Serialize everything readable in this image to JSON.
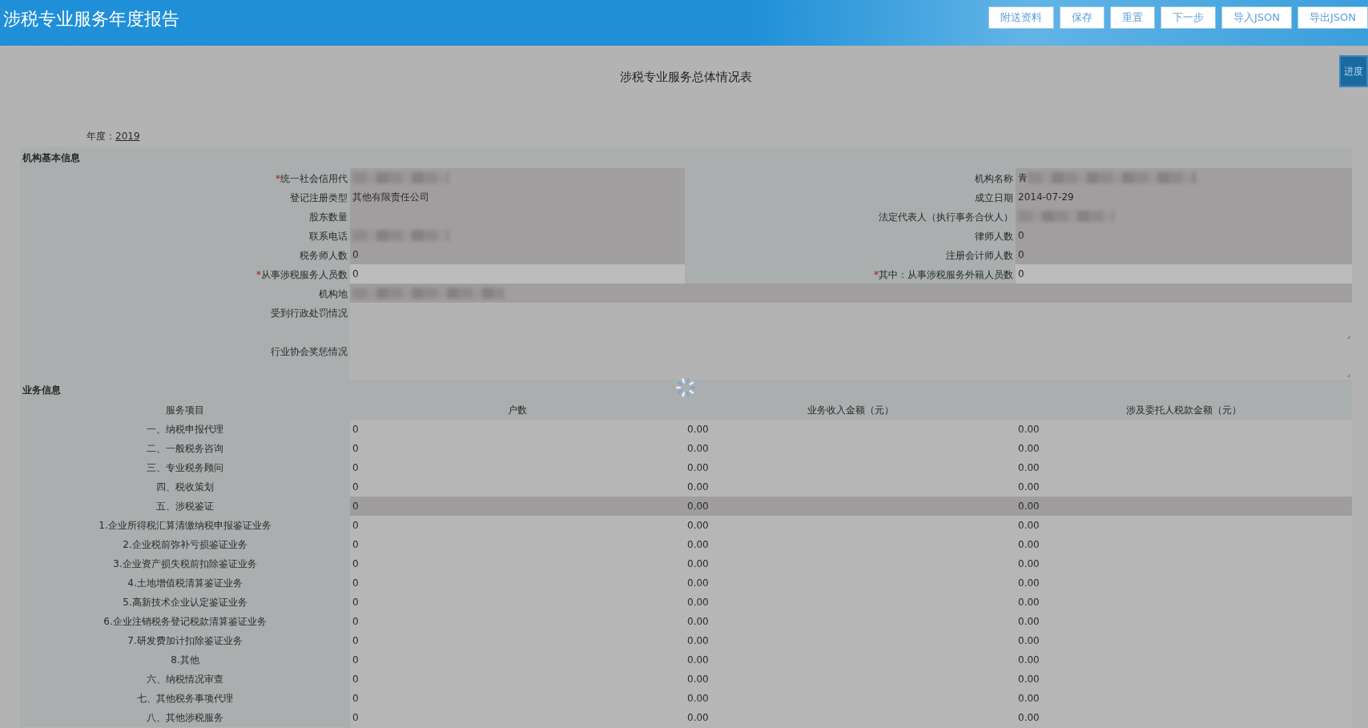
{
  "header": {
    "title": "涉税专业服务年度报告",
    "buttons": [
      "附送资料",
      "保存",
      "重置",
      "下一步",
      "导入JSON",
      "导出JSON"
    ]
  },
  "side_tab": "进度",
  "form_title": "涉税专业服务总体情况表",
  "year": {
    "label": "年度：",
    "value": "2019"
  },
  "loading": true,
  "required_mark": "*",
  "basic_info": {
    "title": "机构基本信息",
    "rows": [
      {
        "kind": "pair",
        "left": {
          "label": "统一社会信用代",
          "required": true,
          "redacted": true,
          "shaded": true
        },
        "right": {
          "label": "机构名称",
          "value": "青",
          "redacted": true,
          "shaded": true
        }
      },
      {
        "kind": "pair",
        "left": {
          "label": "登记注册类型",
          "value": "其他有限责任公司",
          "shaded": true
        },
        "right": {
          "label": "成立日期",
          "value": "2014-07-29",
          "shaded": true
        }
      },
      {
        "kind": "pair",
        "left": {
          "label": "股东数量",
          "shaded": true
        },
        "right": {
          "label": "法定代表人（执行事务合伙人）",
          "redacted": true,
          "shaded": true
        }
      },
      {
        "kind": "pair",
        "left": {
          "label": "联系电话",
          "redacted": true,
          "shaded": true
        },
        "right": {
          "label": "律师人数",
          "value": "0",
          "shaded": true
        }
      },
      {
        "kind": "pair",
        "left": {
          "label": "税务师人数",
          "value": "0",
          "shaded": true
        },
        "right": {
          "label": "注册会计师人数",
          "value": "0",
          "shaded": true
        }
      },
      {
        "kind": "pair",
        "left": {
          "label": "从事涉税服务人员数",
          "required": true,
          "value": "0",
          "shaded": false
        },
        "right": {
          "label": "其中：从事涉税服务外籍人员数",
          "required": true,
          "value": "0",
          "shaded": false
        }
      },
      {
        "kind": "wide",
        "label": "机构地",
        "redacted": true
      },
      {
        "kind": "textarea",
        "label": "受到行政处罚情况"
      },
      {
        "kind": "textarea",
        "label": "行业协会奖惩情况"
      }
    ]
  },
  "business_info": {
    "title": "业务信息",
    "columns": [
      "服务项目",
      "户数",
      "业务收入金额（元）",
      "涉及委托人税款金额（元）"
    ],
    "rows": [
      {
        "item": "一、纳税申报代理",
        "count": "0",
        "income": "0.00",
        "tax": "0.00",
        "selected": false
      },
      {
        "item": "二、一般税务咨询",
        "count": "0",
        "income": "0.00",
        "tax": "0.00",
        "selected": false
      },
      {
        "item": "三、专业税务顾问",
        "count": "0",
        "income": "0.00",
        "tax": "0.00",
        "selected": false
      },
      {
        "item": "四、税收策划",
        "count": "0",
        "income": "0.00",
        "tax": "0.00",
        "selected": false
      },
      {
        "item": "五、涉税鉴证",
        "count": "0",
        "income": "0.00",
        "tax": "0.00",
        "selected": true
      },
      {
        "item": "1.企业所得税汇算清缴纳税申报鉴证业务",
        "count": "0",
        "income": "0.00",
        "tax": "0.00",
        "selected": false
      },
      {
        "item": "2.企业税前弥补亏损鉴证业务",
        "count": "0",
        "income": "0.00",
        "tax": "0.00",
        "selected": false
      },
      {
        "item": "3.企业资产损失税前扣除鉴证业务",
        "count": "0",
        "income": "0.00",
        "tax": "0.00",
        "selected": false
      },
      {
        "item": "4.土地增值税清算鉴证业务",
        "count": "0",
        "income": "0.00",
        "tax": "0.00",
        "selected": false
      },
      {
        "item": "5.高新技术企业认定鉴证业务",
        "count": "0",
        "income": "0.00",
        "tax": "0.00",
        "selected": false
      },
      {
        "item": "6.企业注销税务登记税款清算鉴证业务",
        "count": "0",
        "income": "0.00",
        "tax": "0.00",
        "selected": false
      },
      {
        "item": "7.研发费加计扣除鉴证业务",
        "count": "0",
        "income": "0.00",
        "tax": "0.00",
        "selected": false
      },
      {
        "item": "8.其他",
        "count": "0",
        "income": "0.00",
        "tax": "0.00",
        "selected": false
      },
      {
        "item": "六、纳税情况审查",
        "count": "0",
        "income": "0.00",
        "tax": "0.00",
        "selected": false
      },
      {
        "item": "七、其他税务事项代理",
        "count": "0",
        "income": "0.00",
        "tax": "0.00",
        "selected": false
      },
      {
        "item": "八、其他涉税服务",
        "count": "0",
        "income": "0.00",
        "tax": "0.00",
        "selected": false
      }
    ]
  }
}
